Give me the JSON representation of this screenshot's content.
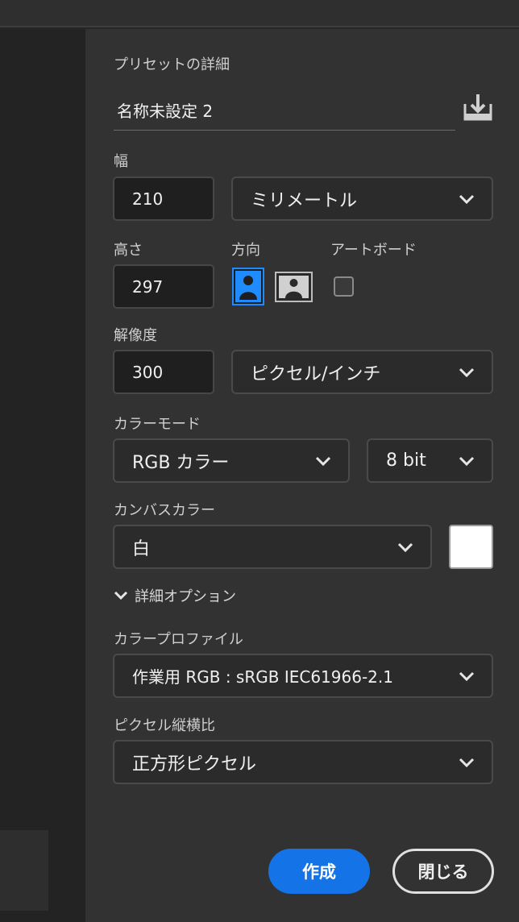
{
  "preset": {
    "title": "プリセットの詳細",
    "name": "名称未設定 2"
  },
  "width": {
    "label": "幅",
    "value": "210",
    "unit": "ミリメートル"
  },
  "height": {
    "label": "高さ",
    "value": "297"
  },
  "orientation": {
    "label": "方向"
  },
  "artboard": {
    "label": "アートボード"
  },
  "resolution": {
    "label": "解像度",
    "value": "300",
    "unit": "ピクセル/インチ"
  },
  "color_mode": {
    "label": "カラーモード",
    "mode": "RGB カラー",
    "depth": "8 bit"
  },
  "canvas_color": {
    "label": "カンバスカラー",
    "value": "白",
    "swatch": "#ffffff"
  },
  "advanced": {
    "label": "詳細オプション"
  },
  "color_profile": {
    "label": "カラープロファイル",
    "value": "作業用 RGB : sRGB IEC61966-2.1"
  },
  "pixel_aspect": {
    "label": "ピクセル縦横比",
    "value": "正方形ピクセル"
  },
  "buttons": {
    "create": "作成",
    "close": "閉じる"
  },
  "colors": {
    "accent": "#1473e6",
    "panel_bg": "#323232",
    "field_bg": "#1f1f1f"
  }
}
